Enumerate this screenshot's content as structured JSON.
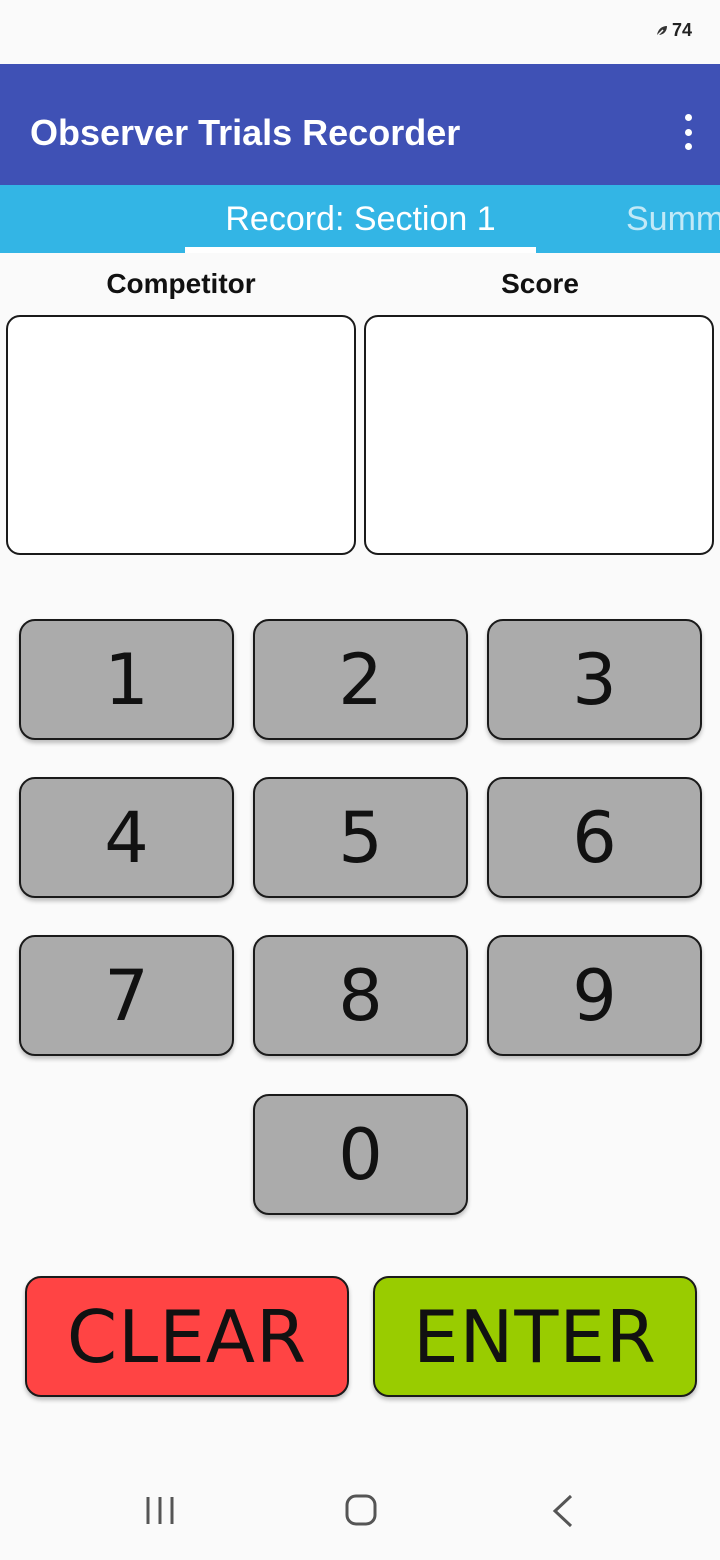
{
  "status_bar": {
    "battery_level": "74"
  },
  "app_bar": {
    "title": "Observer Trials Recorder"
  },
  "tabs": [
    {
      "label": "Record: Section 1",
      "active": true
    },
    {
      "label": "Summ",
      "active": false
    }
  ],
  "fields": {
    "competitor_label": "Competitor",
    "competitor_value": "",
    "score_label": "Score",
    "score_value": ""
  },
  "keypad": {
    "keys": [
      "1",
      "2",
      "3",
      "4",
      "5",
      "6",
      "7",
      "8",
      "9",
      "0"
    ]
  },
  "actions": {
    "clear_label": "CLEAR",
    "enter_label": "ENTER"
  },
  "colors": {
    "app_bar": "#3f51b5",
    "tab_bar": "#33b5e5",
    "key_bg": "#ababab",
    "clear_bg": "#ff4444",
    "enter_bg": "#99cc00"
  }
}
